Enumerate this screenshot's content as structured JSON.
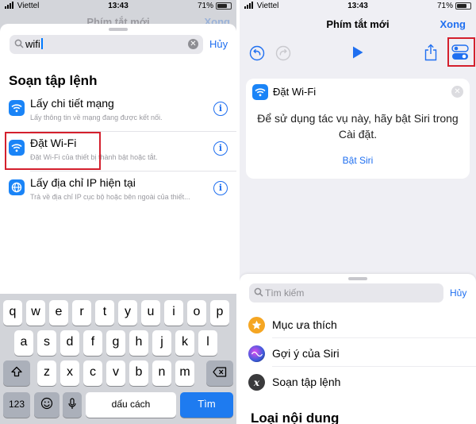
{
  "status_left": {
    "carrier": "Viettel",
    "time": "13:43",
    "battery": "71%"
  },
  "status_right": {
    "carrier": "Viettel",
    "time": "13:43",
    "battery": "71%"
  },
  "left": {
    "background_title": "Phím tắt mới",
    "background_done": "Xong",
    "search": {
      "value": "wifi",
      "cancel": "Hủy"
    },
    "section_title": "Soạn tập lệnh",
    "results": [
      {
        "title": "Lấy chi tiết mạng",
        "subtitle": "Lấy thông tin về mạng đang được kết nối."
      },
      {
        "title": "Đặt Wi-Fi",
        "subtitle": "Đặt Wi-Fi của thiết bị thành bật hoặc tắt."
      },
      {
        "title": "Lấy địa chỉ IP hiện tại",
        "subtitle": "Trả về địa chỉ IP cục bộ hoặc bên ngoài của thiết..."
      }
    ],
    "keyboard": {
      "row1": [
        "q",
        "w",
        "e",
        "r",
        "t",
        "y",
        "u",
        "i",
        "o",
        "p"
      ],
      "row2": [
        "a",
        "s",
        "d",
        "f",
        "g",
        "h",
        "j",
        "k",
        "l"
      ],
      "row3": [
        "z",
        "x",
        "c",
        "v",
        "b",
        "n",
        "m"
      ],
      "numbers": "123",
      "space": "dấu cách",
      "go": "Tìm"
    }
  },
  "right": {
    "title": "Phím tắt mới",
    "done": "Xong",
    "card": {
      "title": "Đặt Wi-Fi",
      "message": "Để sử dụng tác vụ này, hãy bật Siri trong Cài đặt.",
      "link": "Bật Siri"
    },
    "library": {
      "search_placeholder": "Tìm kiếm",
      "cancel": "Hủy",
      "items": [
        {
          "label": "Mục ưa thích",
          "icon": "star-icon"
        },
        {
          "label": "Gợi ý của Siri",
          "icon": "siri-icon"
        },
        {
          "label": "Soạn tập lệnh",
          "icon": "script-icon"
        }
      ],
      "section": "Loại nội dung"
    }
  },
  "colors": {
    "accent": "#1f6ff0",
    "highlight": "#d4202d",
    "wifi_icon_bg": "#1a84f7",
    "go_key": "#1e7bf0"
  }
}
